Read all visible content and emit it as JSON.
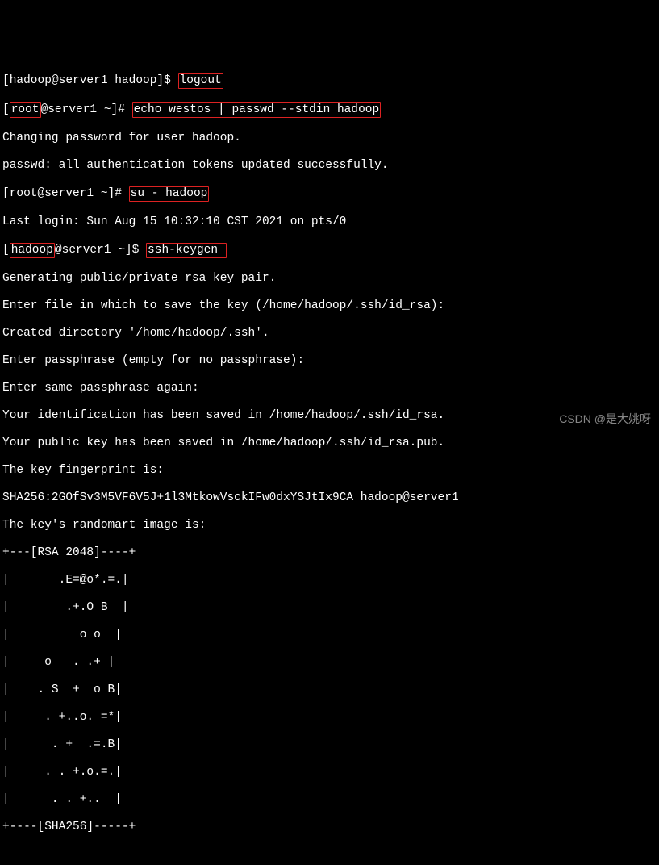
{
  "line1": {
    "prompt": "[hadoop@server1 hadoop]$ ",
    "cmd": "logout"
  },
  "line2": {
    "prefix": "[",
    "root": "root",
    "prompt_rest": "@server1 ~]# ",
    "cmd": "echo westos | passwd --stdin hadoop"
  },
  "line3": "Changing password for user hadoop.",
  "line4": "passwd: all authentication tokens updated successfully.",
  "line5": {
    "prompt": "[root@server1 ~]# ",
    "cmd": "su - hadoop"
  },
  "line6": "Last login: Sun Aug 15 10:32:10 CST 2021 on pts/0",
  "line7": {
    "prefix": "[",
    "hadoop": "hadoop",
    "prompt_rest": "@server1 ~]$ ",
    "cmd": "ssh-keygen "
  },
  "line8": "Generating public/private rsa key pair.",
  "line9": "Enter file in which to save the key (/home/hadoop/.ssh/id_rsa):",
  "line10": "Created directory '/home/hadoop/.ssh'.",
  "line11": "Enter passphrase (empty for no passphrase):",
  "line12": "Enter same passphrase again:",
  "line13": "Your identification has been saved in /home/hadoop/.ssh/id_rsa.",
  "line14": "Your public key has been saved in /home/hadoop/.ssh/id_rsa.pub.",
  "line15": "The key fingerprint is:",
  "line16": "SHA256:2GOfSv3M5VF6V5J+1l3MtkowVsckIFw0dxYSJtIx9CA hadoop@server1",
  "line17": "The key's randomart image is:",
  "line18": "+---[RSA 2048]----+",
  "line19": "|       .E=@o*.=.|",
  "line20": "|        .+.O B  |",
  "line21": "|          o o  |",
  "line22": "|     o   . .+ |",
  "line23": "|    . S  +  o B|",
  "line24": "|     . +..o. =*|",
  "line25": "|      . +  .=.B|",
  "line26": "|     . . +.o.=.|",
  "line27": "|      . . +..  |",
  "line28": "+----[SHA256]-----+",
  "watermark": "CSDN @是大姚呀"
}
